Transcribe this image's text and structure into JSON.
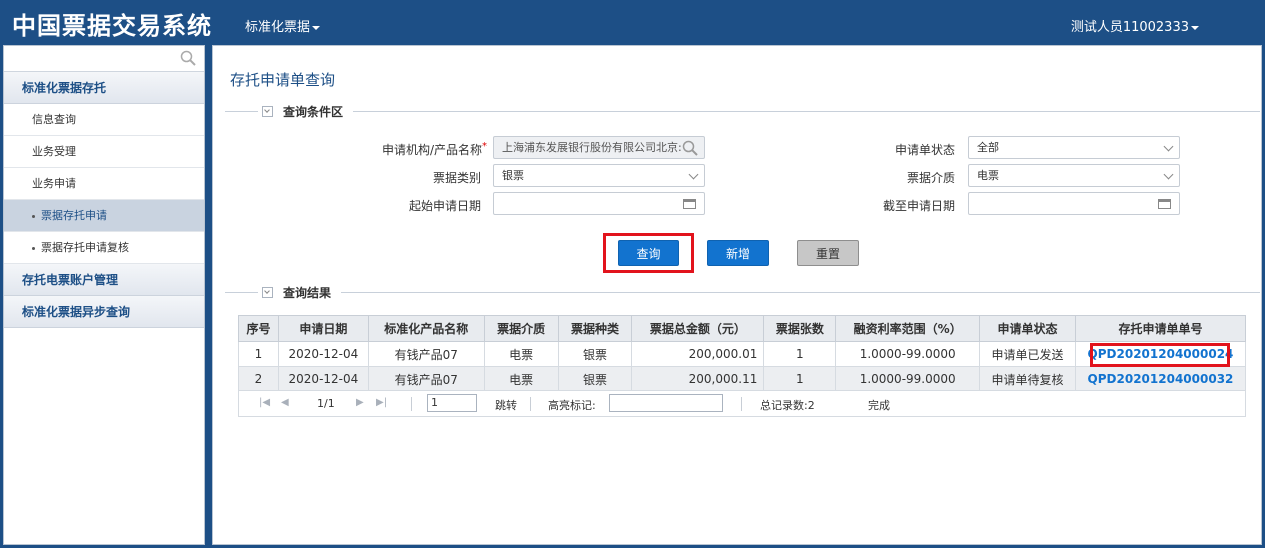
{
  "header": {
    "app_title": "中国票据交易系统",
    "module_menu": "标准化票据",
    "user_menu": "测试人员11002333"
  },
  "sidebar": {
    "groups": [
      {
        "label": "标准化票据存托"
      },
      {
        "label": "存托电票账户管理"
      },
      {
        "label": "标准化票据异步查询"
      }
    ],
    "items": [
      {
        "label": "信息查询"
      },
      {
        "label": "业务受理"
      },
      {
        "label": "业务申请"
      }
    ],
    "subitems": [
      {
        "label": "票据存托申请",
        "active": true
      },
      {
        "label": "票据存托申请复核",
        "active": false
      }
    ]
  },
  "main": {
    "page_title": "存托申请单查询",
    "criteria_section": "查询条件区",
    "results_section": "查询结果",
    "fields": {
      "institution_label": "申请机构/产品名称",
      "institution_value": "上海浦东发展银行股份有限公司北京:",
      "status_label": "申请单状态",
      "status_value": "全部",
      "bill_type_label": "票据类别",
      "bill_type_value": "银票",
      "medium_label": "票据介质",
      "medium_value": "电票",
      "start_date_label": "起始申请日期",
      "start_date_value": "",
      "end_date_label": "截至申请日期",
      "end_date_value": ""
    },
    "buttons": {
      "query": "查询",
      "add": "新增",
      "reset": "重置"
    },
    "table": {
      "headers": [
        "序号",
        "申请日期",
        "标准化产品名称",
        "票据介质",
        "票据种类",
        "票据总金额（元）",
        "票据张数",
        "融资利率范围（%）",
        "申请单状态",
        "存托申请单单号"
      ],
      "rows": [
        [
          "1",
          "2020-12-04",
          "有钱产品07",
          "电票",
          "银票",
          "200,000.01",
          "1",
          "1.0000-99.0000",
          "申请单已发送",
          "QPD20201204000024"
        ],
        [
          "2",
          "2020-12-04",
          "有钱产品07",
          "电票",
          "银票",
          "200,000.11",
          "1",
          "1.0000-99.0000",
          "申请单待复核",
          "QPD20201204000032"
        ]
      ]
    },
    "pager": {
      "page_info": "1/1",
      "page_input": "1",
      "jump_label": "跳转",
      "highlight_label": "高亮标记:",
      "highlight_value": "",
      "total": "总记录数:2",
      "status": "完成"
    }
  }
}
